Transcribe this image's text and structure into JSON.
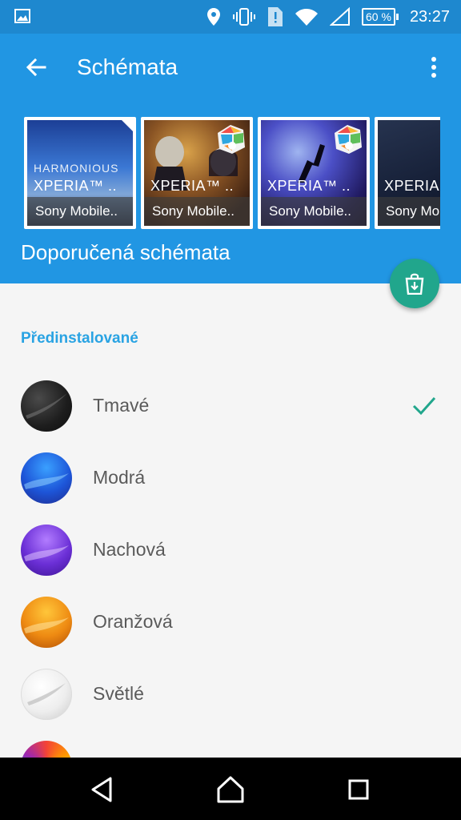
{
  "status": {
    "battery": "60 %",
    "time": "23:27"
  },
  "appbar": {
    "title": "Schémata"
  },
  "featured": {
    "caption": "Doporučená schémata",
    "cards": [
      {
        "name": "XPERIA™ ..",
        "author": "Sony Mobile..",
        "overlay": "HARMONIOUS"
      },
      {
        "name": "XPERIA™ ..",
        "author": "Sony Mobile.."
      },
      {
        "name": "XPERIA™ ..",
        "author": "Sony Mobile.."
      },
      {
        "name": "XPERIA™ ..",
        "author": "Sony Mobile.."
      }
    ]
  },
  "preinstalled": {
    "section_title": "Předinstalované",
    "items": [
      {
        "label": "Tmavé",
        "color": "#2a2a2a",
        "selected": true
      },
      {
        "label": "Modrá",
        "color": "#1e5fd6"
      },
      {
        "label": "Nachová",
        "color": "#6a2fd0"
      },
      {
        "label": "Oranžová",
        "color": "#e88a12"
      },
      {
        "label": "Světlé",
        "color": "#e8e8e8"
      },
      {
        "label": "",
        "color": "#e64a3a"
      }
    ]
  },
  "colors": {
    "appbar": "#2196e3",
    "fab": "#21a68c",
    "section": "#29a3e3",
    "check": "#21a68c"
  }
}
